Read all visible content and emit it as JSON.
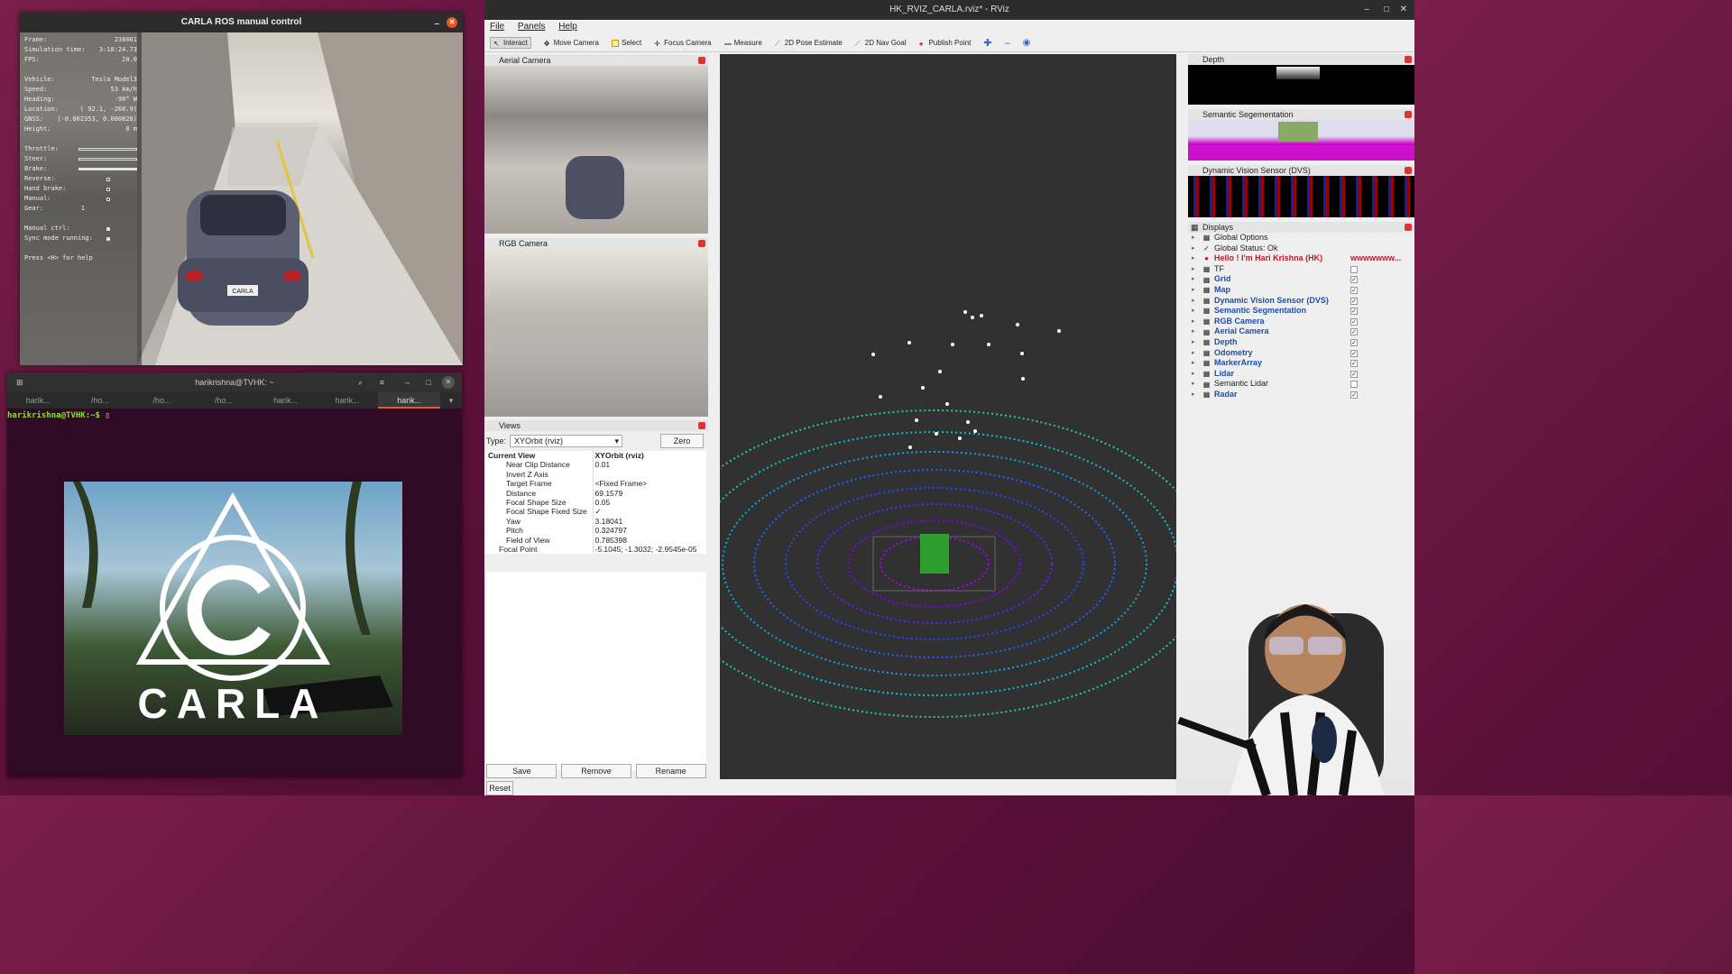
{
  "carla_window": {
    "title": "CARLA ROS manual control",
    "hud": {
      "frame_label": "Frame:",
      "frame_value": "238061",
      "sim_time_label": "Simulation time:",
      "sim_time_value": "3:18:24.73",
      "fps_label": "FPS:",
      "fps_value": "20.0",
      "vehicle_label": "Vehicle:",
      "vehicle_value": "Tesla Model3",
      "speed_label": "Speed:",
      "speed_value": "53 km/h",
      "heading_label": "Heading:",
      "heading_value": "-90° W",
      "location_label": "Location:",
      "location_value": "( 92.1, -260.9)",
      "gnss_label": "GNSS:",
      "gnss_value": "(-0.002353, 0.000828)",
      "height_label": "Height:",
      "height_value": "0 m",
      "throttle_label": "Throttle:",
      "steer_label": "Steer:",
      "brake_label": "Brake:",
      "reverse_label": "Reverse:",
      "handbrake_label": "Hand brake:",
      "manual_label": "Manual:",
      "gear_label": "Gear:",
      "gear_value": "1",
      "manual_ctrl_label": "Manual ctrl:",
      "sync_label": "Sync mode running:",
      "help": "Press <H> for help"
    },
    "plate": "CARLA"
  },
  "terminal": {
    "title": "harikrishna@TVHK: ~",
    "tabs": [
      "harik...",
      "/ho...",
      "/ho...",
      "/ho...",
      "harik...",
      "harik...",
      "harik..."
    ],
    "prompt": "harikrishna@TVHK:~$ "
  },
  "logo": {
    "text": "CARLA"
  },
  "rviz": {
    "title": "HK_RVIZ_CARLA.rviz* - RViz",
    "menu": [
      "File",
      "Panels",
      "Help"
    ],
    "tools": [
      "Interact",
      "Move Camera",
      "Select",
      "Focus Camera",
      "Measure",
      "2D Pose Estimate",
      "2D Nav Goal",
      "Publish Point"
    ],
    "aerial_title": "Aerial Camera",
    "rgb_title": "RGB Camera",
    "views": {
      "title": "Views",
      "type_label": "Type:",
      "type_value": "XYOrbit (rviz)",
      "zero": "Zero",
      "rows": [
        {
          "k": "Current View",
          "v": "XYOrbit (rviz)"
        },
        {
          "k": "Near Clip Distance",
          "v": "0.01"
        },
        {
          "k": "Invert Z Axis",
          "v": ""
        },
        {
          "k": "Target Frame",
          "v": "<Fixed Frame>"
        },
        {
          "k": "Distance",
          "v": "69.1579"
        },
        {
          "k": "Focal Shape Size",
          "v": "0.05"
        },
        {
          "k": "Focal Shape Fixed Size",
          "v": "✓"
        },
        {
          "k": "Yaw",
          "v": "3.18041"
        },
        {
          "k": "Pitch",
          "v": "0.324797"
        },
        {
          "k": "Field of View",
          "v": "0.785398"
        },
        {
          "k": "Focal Point",
          "v": "-5.1045; -1.3032; -2.9545e-05"
        }
      ],
      "save": "Save",
      "remove": "Remove",
      "rename": "Rename",
      "reset": "Reset"
    },
    "depth_title": "Depth",
    "semseg_title": "Semantic Segementation",
    "dvs_title": "Dynamic Vision Sensor (DVS)",
    "displays": {
      "title": "Displays",
      "items": [
        {
          "label": "Global Options",
          "checked": null
        },
        {
          "label": "Global Status: Ok",
          "checked": null
        },
        {
          "label": "Hello ! I'm Hari Krishna (HK)",
          "checked": null,
          "extra": "wwwwwww..."
        },
        {
          "label": "TF",
          "checked": false
        },
        {
          "label": "Grid",
          "checked": true
        },
        {
          "label": "Map",
          "checked": true
        },
        {
          "label": "Dynamic Vision Sensor (DVS)",
          "checked": true
        },
        {
          "label": "Semantic Segmentation",
          "checked": true
        },
        {
          "label": "RGB Camera",
          "checked": true
        },
        {
          "label": "Aerial Camera",
          "checked": true
        },
        {
          "label": "Depth",
          "checked": true
        },
        {
          "label": "Odometry",
          "checked": true
        },
        {
          "label": "MarkerArray",
          "checked": true
        },
        {
          "label": "Lidar",
          "checked": true
        },
        {
          "label": "Semantic Lidar",
          "checked": false
        },
        {
          "label": "Radar",
          "checked": true
        }
      ]
    },
    "colors": {
      "accent": "#e95420",
      "display_blue": "#1e4fa8",
      "hello_red": "#c0182a"
    }
  }
}
